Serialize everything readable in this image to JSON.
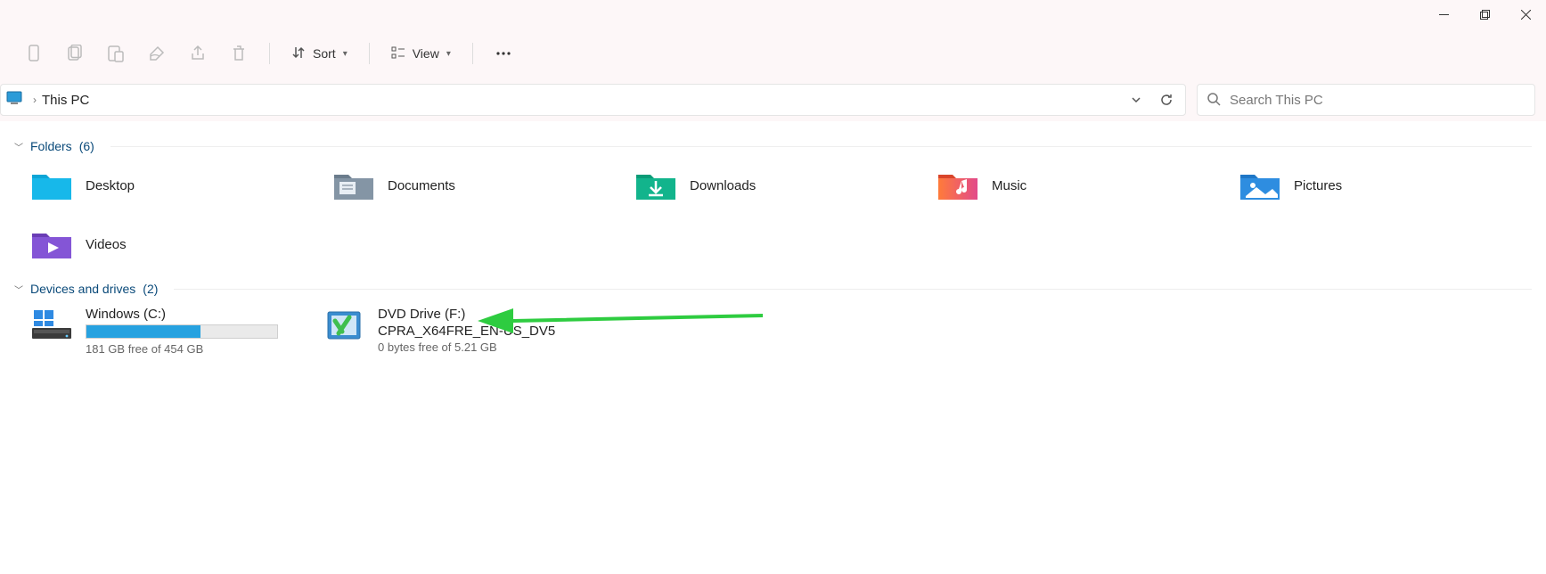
{
  "toolbar": {
    "sort_label": "Sort",
    "view_label": "View"
  },
  "address": {
    "location": "This PC"
  },
  "search": {
    "placeholder": "Search This PC"
  },
  "groups": {
    "folders": {
      "label": "Folders",
      "count": "(6)"
    },
    "drives": {
      "label": "Devices and drives",
      "count": "(2)"
    }
  },
  "folders": [
    {
      "name": "Desktop"
    },
    {
      "name": "Documents"
    },
    {
      "name": "Downloads"
    },
    {
      "name": "Music"
    },
    {
      "name": "Pictures"
    },
    {
      "name": "Videos"
    }
  ],
  "drives": {
    "c": {
      "name": "Windows (C:)",
      "free_text": "181 GB free of 454 GB",
      "used_pct": 60
    },
    "dvd": {
      "line1": "DVD Drive (F:)",
      "line2": "CPRA_X64FRE_EN-US_DV5",
      "free_text": "0 bytes free of 5.21 GB"
    }
  }
}
